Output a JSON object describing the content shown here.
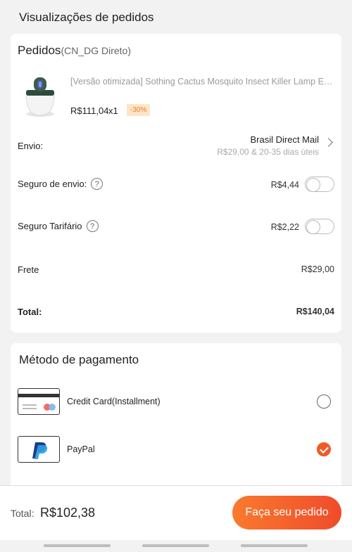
{
  "page": {
    "title": "Visualizações de pedidos"
  },
  "order": {
    "header": "Pedidos",
    "seller": "(CN_DG Direto)",
    "product": {
      "title": "[Versão otimizada] Sothing Cactus Mosquito Insect Killer Lamp Elétri...",
      "price": "R$111,04",
      "quantity": "x1",
      "discount": "-30%"
    },
    "shipping": {
      "label": "Envio:",
      "method": "Brasil Direct Mail",
      "detail": "R$29,00 & 20-35 dias úteis"
    },
    "shipping_insurance": {
      "label": "Seguro de envio:",
      "value": "R$4,44",
      "enabled": false
    },
    "tariff_insurance": {
      "label": "Seguro Tarifário",
      "value": "R$2,22",
      "enabled": false
    },
    "freight": {
      "label": "Frete",
      "value": "R$29,00"
    },
    "total": {
      "label": "Total:",
      "value": "R$140,04"
    }
  },
  "payment": {
    "title": "Método de pagamento",
    "options": [
      {
        "label": "Credit Card(Installment)",
        "icon": "credit-card-icon",
        "selected": false
      },
      {
        "label": "PayPal",
        "icon": "paypal-icon",
        "selected": true
      }
    ]
  },
  "footer": {
    "total_label": "Total:",
    "total_value": "R$102,38",
    "order_button": "Faça seu pedido"
  },
  "colors": {
    "accent": "#f05a28",
    "discount_bg": "#fde6c5",
    "discount_text": "#f07a2e"
  },
  "help_glyph": "?"
}
